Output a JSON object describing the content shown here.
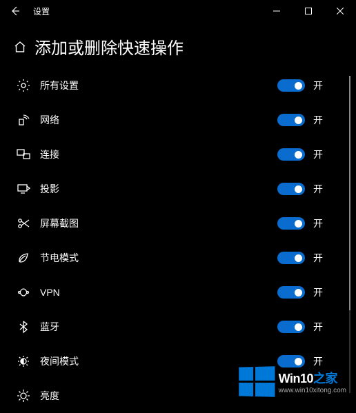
{
  "titlebar": {
    "title": "设置"
  },
  "page": {
    "heading": "添加或删除快速操作"
  },
  "toggle_on_label": "开",
  "items": [
    {
      "key": "all-settings",
      "label": "所有设置",
      "on": true
    },
    {
      "key": "network",
      "label": "网络",
      "on": true
    },
    {
      "key": "connect",
      "label": "连接",
      "on": true
    },
    {
      "key": "project",
      "label": "投影",
      "on": true
    },
    {
      "key": "screen-snip",
      "label": "屏幕截图",
      "on": true
    },
    {
      "key": "battery-saver",
      "label": "节电模式",
      "on": true
    },
    {
      "key": "vpn",
      "label": "VPN",
      "on": true
    },
    {
      "key": "bluetooth",
      "label": "蓝牙",
      "on": true
    },
    {
      "key": "night-light",
      "label": "夜间模式",
      "on": true
    },
    {
      "key": "brightness",
      "label": "亮度",
      "on": true
    }
  ],
  "watermark": {
    "brand_prefix": "Win10",
    "brand_suffix": "之家",
    "url": "www.win10xitong.com"
  }
}
